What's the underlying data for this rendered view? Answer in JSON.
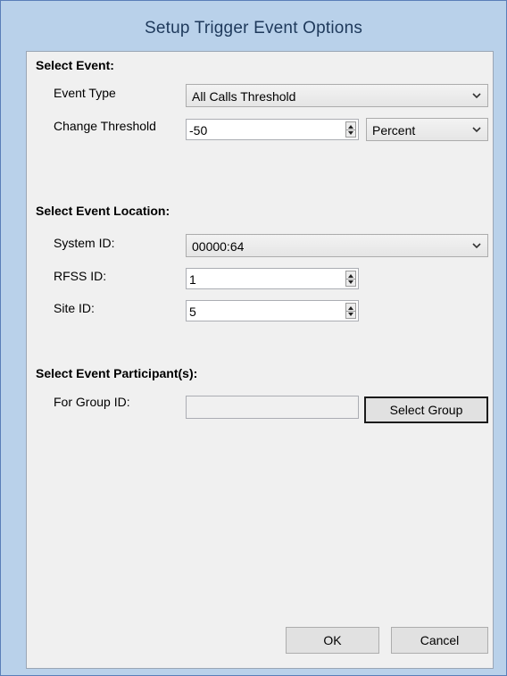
{
  "window": {
    "title": "Setup Trigger Event Options"
  },
  "select_event": {
    "heading": "Select Event:",
    "event_type_label": "Event Type",
    "event_type_value": "All Calls Threshold",
    "change_threshold_label": "Change Threshold",
    "change_threshold_value": "-50",
    "threshold_unit_value": "Percent"
  },
  "event_location": {
    "heading": "Select Event Location:",
    "system_id_label": "System ID:",
    "system_id_value": "00000:64",
    "rfss_id_label": "RFSS ID:",
    "rfss_id_value": "1",
    "site_id_label": "Site ID:",
    "site_id_value": "5"
  },
  "event_participants": {
    "heading": "Select Event Participant(s):",
    "group_id_label": "For Group ID:",
    "group_id_value": "",
    "select_group_label": "Select Group"
  },
  "footer": {
    "ok_label": "OK",
    "cancel_label": "Cancel"
  }
}
